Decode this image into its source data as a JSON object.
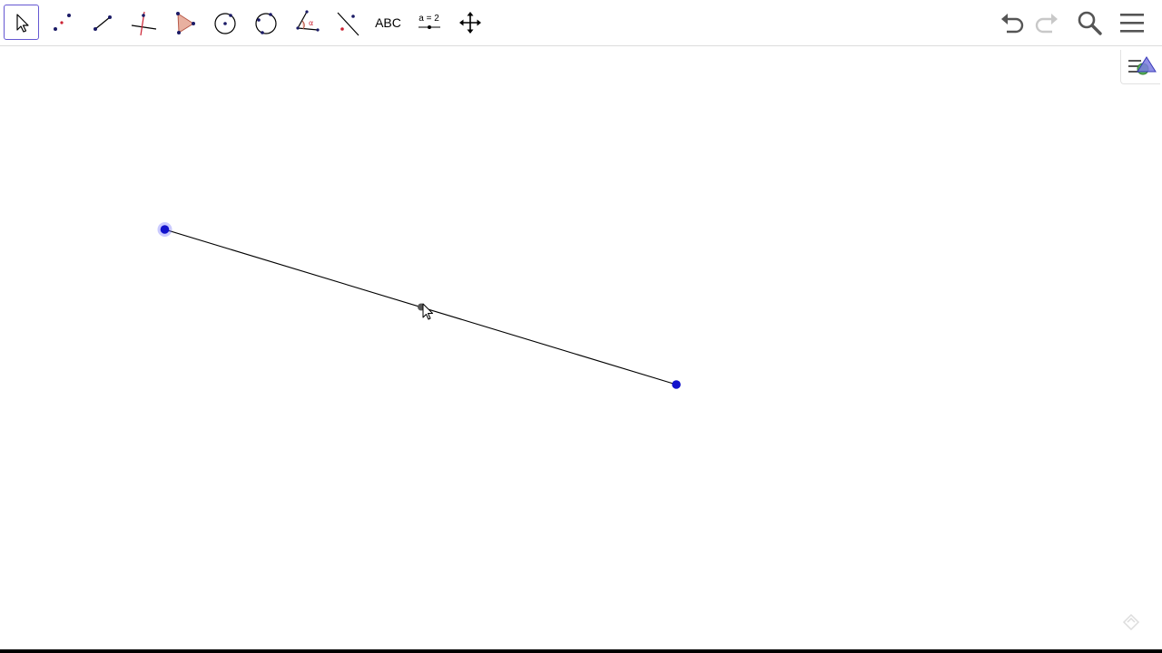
{
  "toolbar": {
    "tools": [
      {
        "name": "move-tool",
        "icon": "arrow-cursor-icon",
        "selected": true
      },
      {
        "name": "point-tool",
        "icon": "point-icon"
      },
      {
        "name": "segment-tool",
        "icon": "segment-icon"
      },
      {
        "name": "perpendicular-line-tool",
        "icon": "perpendicular-icon"
      },
      {
        "name": "polygon-tool",
        "icon": "polygon-icon"
      },
      {
        "name": "circle-tool",
        "icon": "circle-center-point-icon"
      },
      {
        "name": "circle-three-points-tool",
        "icon": "circle-three-points-icon"
      },
      {
        "name": "angle-tool",
        "icon": "angle-icon"
      },
      {
        "name": "reflect-tool",
        "icon": "reflect-line-icon"
      },
      {
        "name": "text-tool",
        "label": "ABC"
      },
      {
        "name": "slider-tool",
        "label": "a = 2"
      },
      {
        "name": "move-graphics-tool",
        "icon": "move-arrows-icon"
      }
    ],
    "right": {
      "undo": "undo-icon",
      "redo": "redo-icon",
      "search": "search-icon",
      "menu": "menu-icon"
    }
  },
  "canvas": {
    "points_color": "#1a1acc",
    "segment_color": "#000000",
    "hover_point_color": "#555555"
  },
  "colors": {
    "accent": "#6557d2",
    "point": "#0000cc"
  }
}
